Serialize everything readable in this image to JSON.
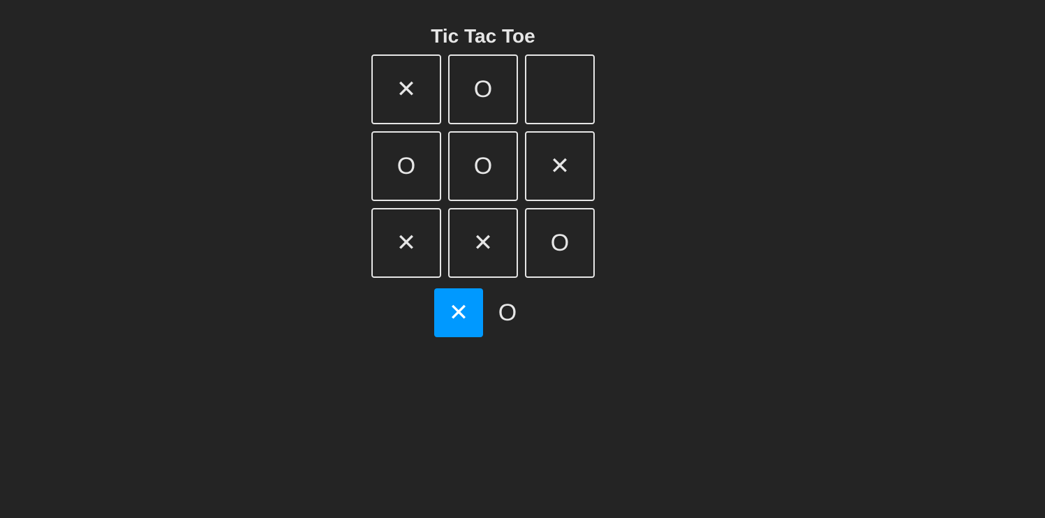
{
  "title": "Tic Tac Toe",
  "board": {
    "cells": [
      "✕",
      "O",
      "",
      "O",
      "O",
      "✕",
      "✕",
      "✕",
      "O"
    ]
  },
  "turn_indicator": {
    "x_label": "✕",
    "o_label": "O",
    "active": "x"
  },
  "colors": {
    "background": "#242424",
    "foreground": "#e6e6e6",
    "active_turn": "#0099ff"
  }
}
